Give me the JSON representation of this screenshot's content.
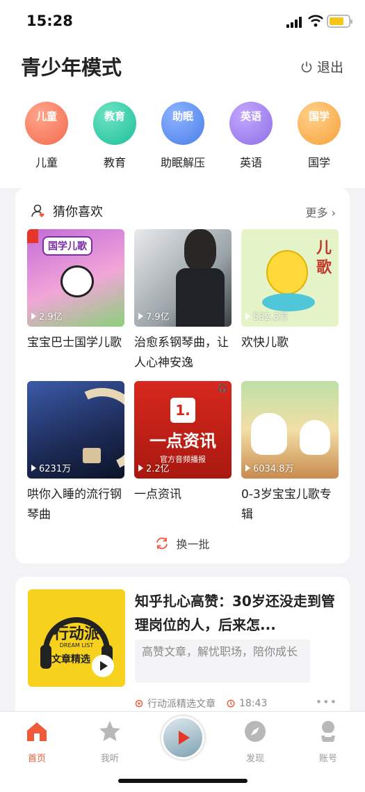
{
  "status": {
    "time": "15:28"
  },
  "header": {
    "title": "青少年模式",
    "exit_label": "退出"
  },
  "categories": [
    {
      "label": "儿童",
      "icon_text": "儿童",
      "icon": "child-face-icon",
      "color": "#f46b4f"
    },
    {
      "label": "教育",
      "icon_text": "教育",
      "icon": "graduation-cap-icon",
      "color": "#1dbf9a"
    },
    {
      "label": "助眠解压",
      "icon_text": "助眠",
      "icon": "sleep-icon",
      "color": "#4a7fe8"
    },
    {
      "label": "英语",
      "icon_text": "英语",
      "icon": "english-bubble-icon",
      "color": "#8f6ee6"
    },
    {
      "label": "国学",
      "icon_text": "国学",
      "icon": "book-icon",
      "color": "#f7a23a"
    }
  ],
  "guess": {
    "title": "猜你喜欢",
    "more": "更多",
    "refresh": "换一批",
    "items": [
      {
        "title": "宝宝巴士国学儿歌",
        "plays": "2.9亿",
        "art": "国学儿歌"
      },
      {
        "title": "治愈系钢琴曲，让人心神安逸",
        "plays": "7.9亿"
      },
      {
        "title": "欢快儿歌",
        "plays": "532.3万",
        "art": "儿歌"
      },
      {
        "title": "哄你入睡的流行钢琴曲",
        "plays": "6231万"
      },
      {
        "title": "一点资讯",
        "plays": "2.2亿",
        "art_number": "1.",
        "art_title": "一点资讯",
        "art_sub": "官方音频播报"
      },
      {
        "title": "0-3岁宝宝儿歌专辑",
        "plays": "6034.8万"
      }
    ]
  },
  "article": {
    "title": "知乎扎心高赞：30岁还没走到管理岗位的人，后来怎...",
    "desc": "高赞文章，解忧职场，陪你成长",
    "author": "行动派精选文章",
    "duration": "18:43",
    "cover_title": "行动派",
    "cover_sub": "DREAM LIST",
    "cover_tag": "文章精选"
  },
  "tabs": [
    {
      "label": "首页",
      "icon": "home-icon",
      "active": true
    },
    {
      "label": "我听",
      "icon": "star-icon",
      "active": false
    },
    {
      "label": "",
      "icon": "center-play-icon",
      "active": false
    },
    {
      "label": "发现",
      "icon": "compass-icon",
      "active": false
    },
    {
      "label": "账号",
      "icon": "user-icon",
      "active": false
    }
  ],
  "colors": {
    "accent": "#f05a3a",
    "inactive": "#999999"
  }
}
